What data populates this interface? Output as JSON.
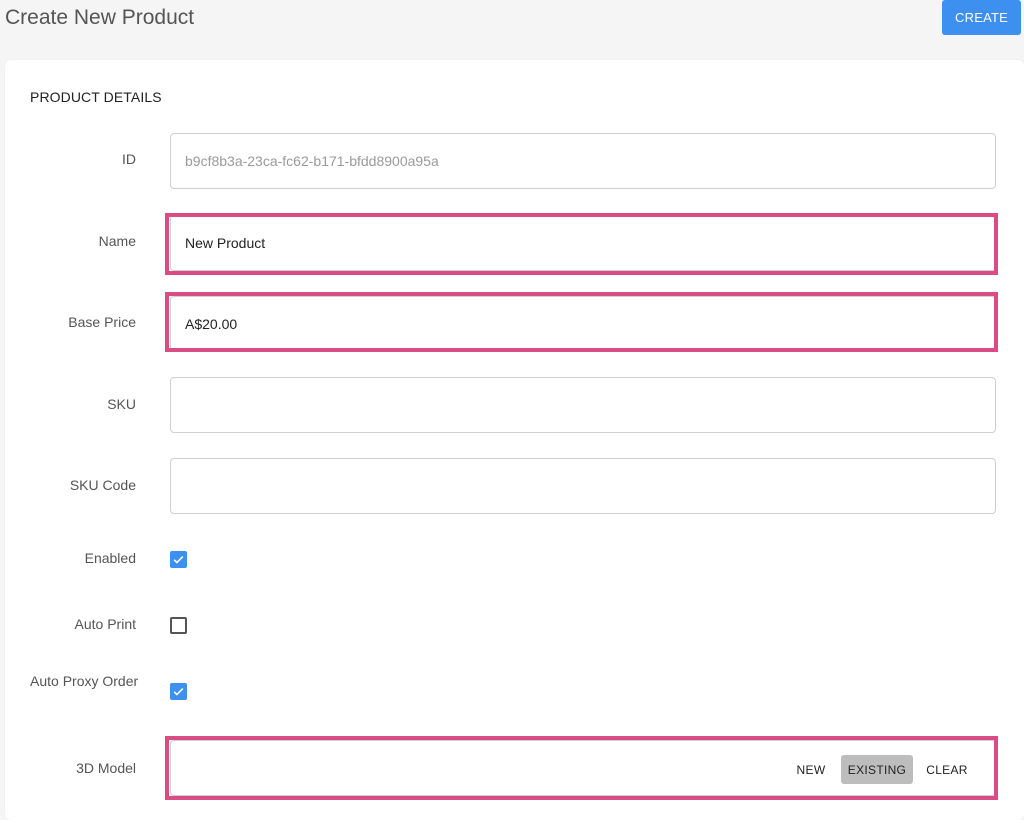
{
  "header": {
    "title": "Create New Product",
    "create_label": "CREATE",
    "accent_color": "#3d8ff0"
  },
  "form": {
    "section_title": "PRODUCT DETAILS",
    "highlight_color": "#d94c84",
    "fields": {
      "id": {
        "label": "ID",
        "value": "b9cf8b3a-23ca-fc62-b171-bfdd8900a95a",
        "readonly": true
      },
      "name": {
        "label": "Name",
        "value": "New Product"
      },
      "base_price": {
        "label": "Base Price",
        "value": "A$20.00"
      },
      "sku": {
        "label": "SKU",
        "value": ""
      },
      "sku_code": {
        "label": "SKU Code",
        "value": ""
      }
    },
    "checkboxes": {
      "enabled": {
        "label": "Enabled",
        "checked": true
      },
      "auto_print": {
        "label": "Auto Print",
        "checked": false
      },
      "auto_proxy_order": {
        "label": "Auto Proxy Order",
        "checked": true
      }
    },
    "model_3d": {
      "label": "3D Model",
      "new_label": "NEW",
      "existing_label": "EXISTING",
      "clear_label": "CLEAR",
      "selected": "EXISTING"
    }
  }
}
